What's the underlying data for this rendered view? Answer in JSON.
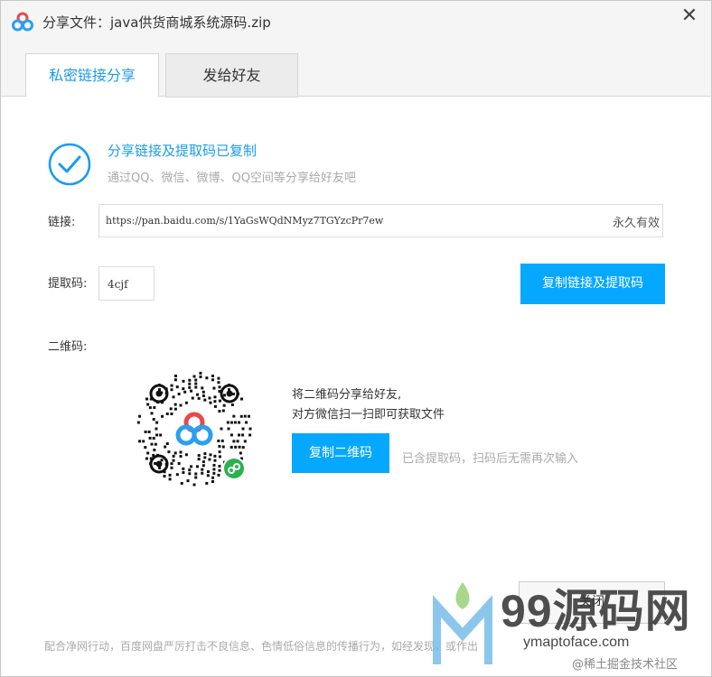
{
  "window": {
    "title": "分享文件：java供货商城系统源码.zip",
    "close_icon": "close-icon"
  },
  "tabs": [
    {
      "label": "私密链接分享",
      "active": true
    },
    {
      "label": "发给好友",
      "active": false
    }
  ],
  "success": {
    "title": "分享链接及提取码已复制",
    "subtitle": "通过QQ、微信、微博、QQ空间等分享给好友吧"
  },
  "link": {
    "label": "链接:",
    "url": "https://pan.baidu.com/s/1YaGsWQdNMyz7TGYzcPr7ew",
    "validity": "永久有效"
  },
  "code": {
    "label": "提取码:",
    "value": "4cjf",
    "copy_button": "复制链接及提取码"
  },
  "qr": {
    "label": "二维码:",
    "hint_line1": "将二维码分享给好友,",
    "hint_line2": "对方微信扫一扫即可获取文件",
    "copy_button": "复制二维码",
    "note": "已含提取码，扫码后无需再次输入"
  },
  "footer": {
    "close_button": "关闭",
    "notice": "配合净网行动，百度网盘严厉打击不良信息、色情低俗信息的传播行为，如经发现，或作出"
  },
  "watermark": {
    "main": "99源码网",
    "domain": "ymaptoface.com",
    "juejin": "@稀土掘金技术社区"
  },
  "colors": {
    "accent": "#1a9bf0",
    "button": "#06a7ff"
  }
}
